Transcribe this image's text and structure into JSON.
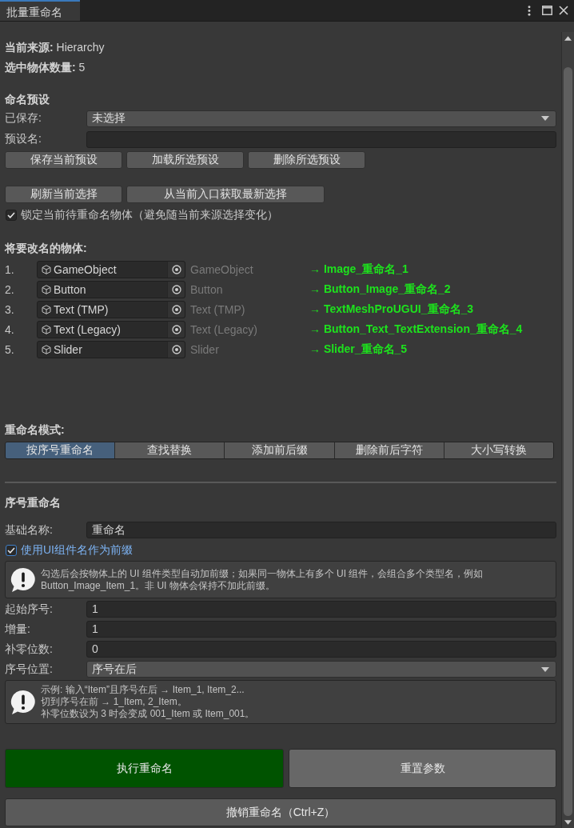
{
  "tabs": [
    {
      "label": "批量重命名",
      "selected": true
    }
  ],
  "info": [
    "**当前来源:** Hierarchy",
    "**选中物体数量:** 5"
  ],
  "presets": {
    "heading": "命名预设",
    "fields": [
      {
        "kind": "dropdown",
        "label": "已保存:",
        "value": "未选择"
      },
      {
        "kind": "text",
        "label": "预设名:"
      }
    ],
    "buttons": [
      "保存当前预设",
      "加载所选预设",
      "删除所选预设"
    ]
  },
  "selection": {
    "buttons": [
      "刷新当前选择",
      "从当前入口获取最新选择"
    ],
    "lock": {
      "label": "锁定当前待重命名物体（避免随当前来源选择变化）",
      "checked": true,
      "focused": false
    }
  },
  "objects": {
    "heading": "将要改名的物体:",
    "rows": [
      {
        "index": "1.",
        "object": "GameObject",
        "name": "GameObject",
        "new_name": "→ Image_重命名_1"
      },
      {
        "index": "2.",
        "object": "Button",
        "name": "Button",
        "new_name": "→ Button_Image_重命名_2"
      },
      {
        "index": "3.",
        "object": "Text (TMP)",
        "name": "Text (TMP)",
        "new_name": "→ TextMeshProUGUI_重命名_3"
      },
      {
        "index": "4.",
        "object": "Text (Legacy)",
        "name": "Text (Legacy)",
        "new_name": "→ Button_Text_TextExtension_重命名_4"
      },
      {
        "index": "5.",
        "object": "Slider",
        "name": "Slider",
        "new_name": "→ Slider_重命名_5"
      }
    ]
  },
  "mode": {
    "heading": "重命名模式:",
    "tabs": [
      {
        "label": "按序号重命名",
        "selected": true
      },
      {
        "label": "查找替换",
        "selected": false
      },
      {
        "label": "添加前后缀",
        "selected": false
      },
      {
        "label": "删除前后字符",
        "selected": false
      },
      {
        "label": "大小写转换",
        "selected": false
      }
    ]
  },
  "sequence": {
    "heading": "序号重命名",
    "rows": [
      {
        "kind": "text",
        "label": "基础名称:",
        "value": "重命名"
      },
      {
        "kind": "checkbox",
        "label": "使用UI组件名作为前缀",
        "checked": true,
        "focused": true
      },
      {
        "kind": "help",
        "lines": [
          "勾选后会按物体上的 UI 组件类型自动加前缀；如果同一物体上有多个 UI 组件，会组合多个类型名，例如 Button_Image_Item_1。非 UI 物体会保持不加此前缀。"
        ]
      },
      {
        "kind": "text",
        "label": "起始序号:",
        "value": "1"
      },
      {
        "kind": "text",
        "label": "增量:",
        "value": "1"
      },
      {
        "kind": "text",
        "label": "补零位数:",
        "value": "0"
      },
      {
        "kind": "dropdown",
        "label": "序号位置:",
        "value": "序号在后"
      },
      {
        "kind": "help",
        "lines": [
          "示例: 输入“Item”且序号在后 → Item_1, Item_2...",
          "切到序号在前 → 1_Item, 2_Item。",
          "补零位数设为 3 时会变成 001_Item 或 Item_001。"
        ]
      }
    ]
  },
  "actions": [
    {
      "kind": "primary",
      "label": "执行重命名"
    },
    {
      "kind": "secondary",
      "label": "重置参数"
    }
  ],
  "undo": {
    "label": "撤销重命名（Ctrl+Z）"
  }
}
